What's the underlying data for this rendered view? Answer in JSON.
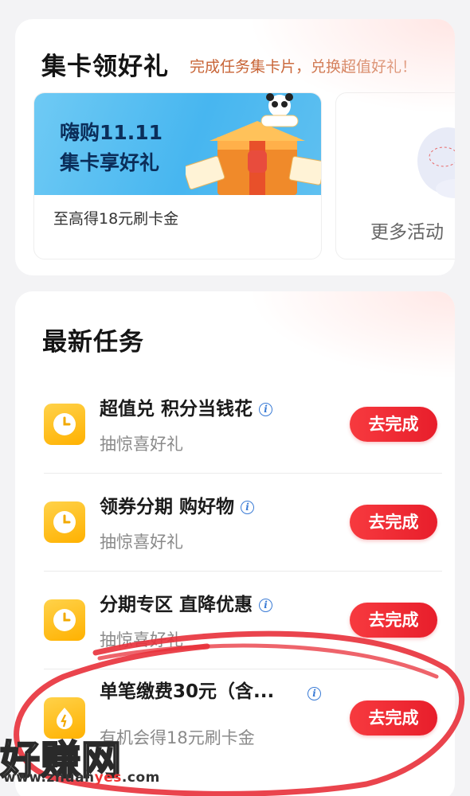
{
  "collect": {
    "title": "集卡领好礼",
    "subtitle": "完成任务集卡片，兑换超值好礼！",
    "promo": {
      "line1": "嗨购11.11",
      "line2": "集卡享好礼",
      "description": "至高得18元刷卡金",
      "art_icon": "panda-gift-box-icon"
    },
    "more": {
      "label": "更多活动",
      "art_icon": "mascot-icon"
    }
  },
  "tasks": {
    "title": "最新任务",
    "items": [
      {
        "title": "超值兑 积分当钱花",
        "subtitle": "抽惊喜好礼",
        "button": "去完成",
        "icon": "clock-icon"
      },
      {
        "title": "领券分期 购好物",
        "subtitle": "抽惊喜好礼",
        "button": "去完成",
        "icon": "clock-icon"
      },
      {
        "title": "分期专区 直降优惠",
        "subtitle": "抽惊喜好礼",
        "button": "去完成",
        "icon": "clock-icon"
      },
      {
        "title": "单笔缴费30元（含...",
        "subtitle": "有机会得18元刷卡金",
        "button": "去完成",
        "icon": "flame-icon"
      }
    ]
  },
  "watermark": {
    "logo": "好赚网",
    "url_prefix": "www.zhuan",
    "url_highlight": "yes",
    "url_suffix": ".com"
  },
  "colors": {
    "accent_red": "#e81e2b",
    "subtitle_orange": "#c86436",
    "icon_yellow": "#ffc21a",
    "annotation_red": "#e8303a"
  }
}
